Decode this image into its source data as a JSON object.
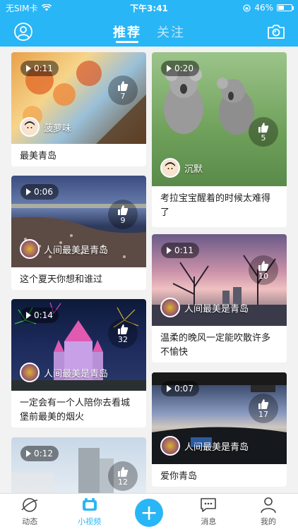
{
  "status_bar": {
    "carrier": "无SIM卡",
    "time": "下午3:41",
    "battery": "46%",
    "battery_level": 0.46
  },
  "header": {
    "tabs": [
      {
        "label": "推荐",
        "active": true
      },
      {
        "label": "关注",
        "active": false
      }
    ]
  },
  "feed": {
    "left": [
      {
        "duration": "0:11",
        "likes": "7",
        "author": "菠萝味",
        "caption": "最美青岛"
      },
      {
        "duration": "0:06",
        "likes": "9",
        "author": "人间最美是青岛",
        "caption": "这个夏天你想和谁过"
      },
      {
        "duration": "0:14",
        "likes": "32",
        "author": "人间最美是青岛",
        "caption": "一定会有一个人陪你去看城堡前最美的烟火"
      },
      {
        "duration": "0:12",
        "likes": "12"
      }
    ],
    "right": [
      {
        "duration": "0:20",
        "likes": "5",
        "author": "沉默",
        "caption": "考拉宝宝醒着的时候太难得了"
      },
      {
        "duration": "0:11",
        "likes": "10",
        "author": "人间最美是青岛",
        "caption": "温柔的晚风一定能吹散许多不愉快"
      },
      {
        "duration": "0:07",
        "likes": "17",
        "author": "人间最美是青岛",
        "caption": "爱你青岛"
      }
    ]
  },
  "bottom_nav": [
    {
      "label": "动态",
      "icon": "planet-icon"
    },
    {
      "label": "小视频",
      "icon": "video-icon",
      "active": true
    },
    {
      "label": "",
      "icon": "plus-icon"
    },
    {
      "label": "消息",
      "icon": "message-icon"
    },
    {
      "label": "我的",
      "icon": "profile-icon"
    }
  ],
  "colors": {
    "accent": "#29b6f6"
  }
}
